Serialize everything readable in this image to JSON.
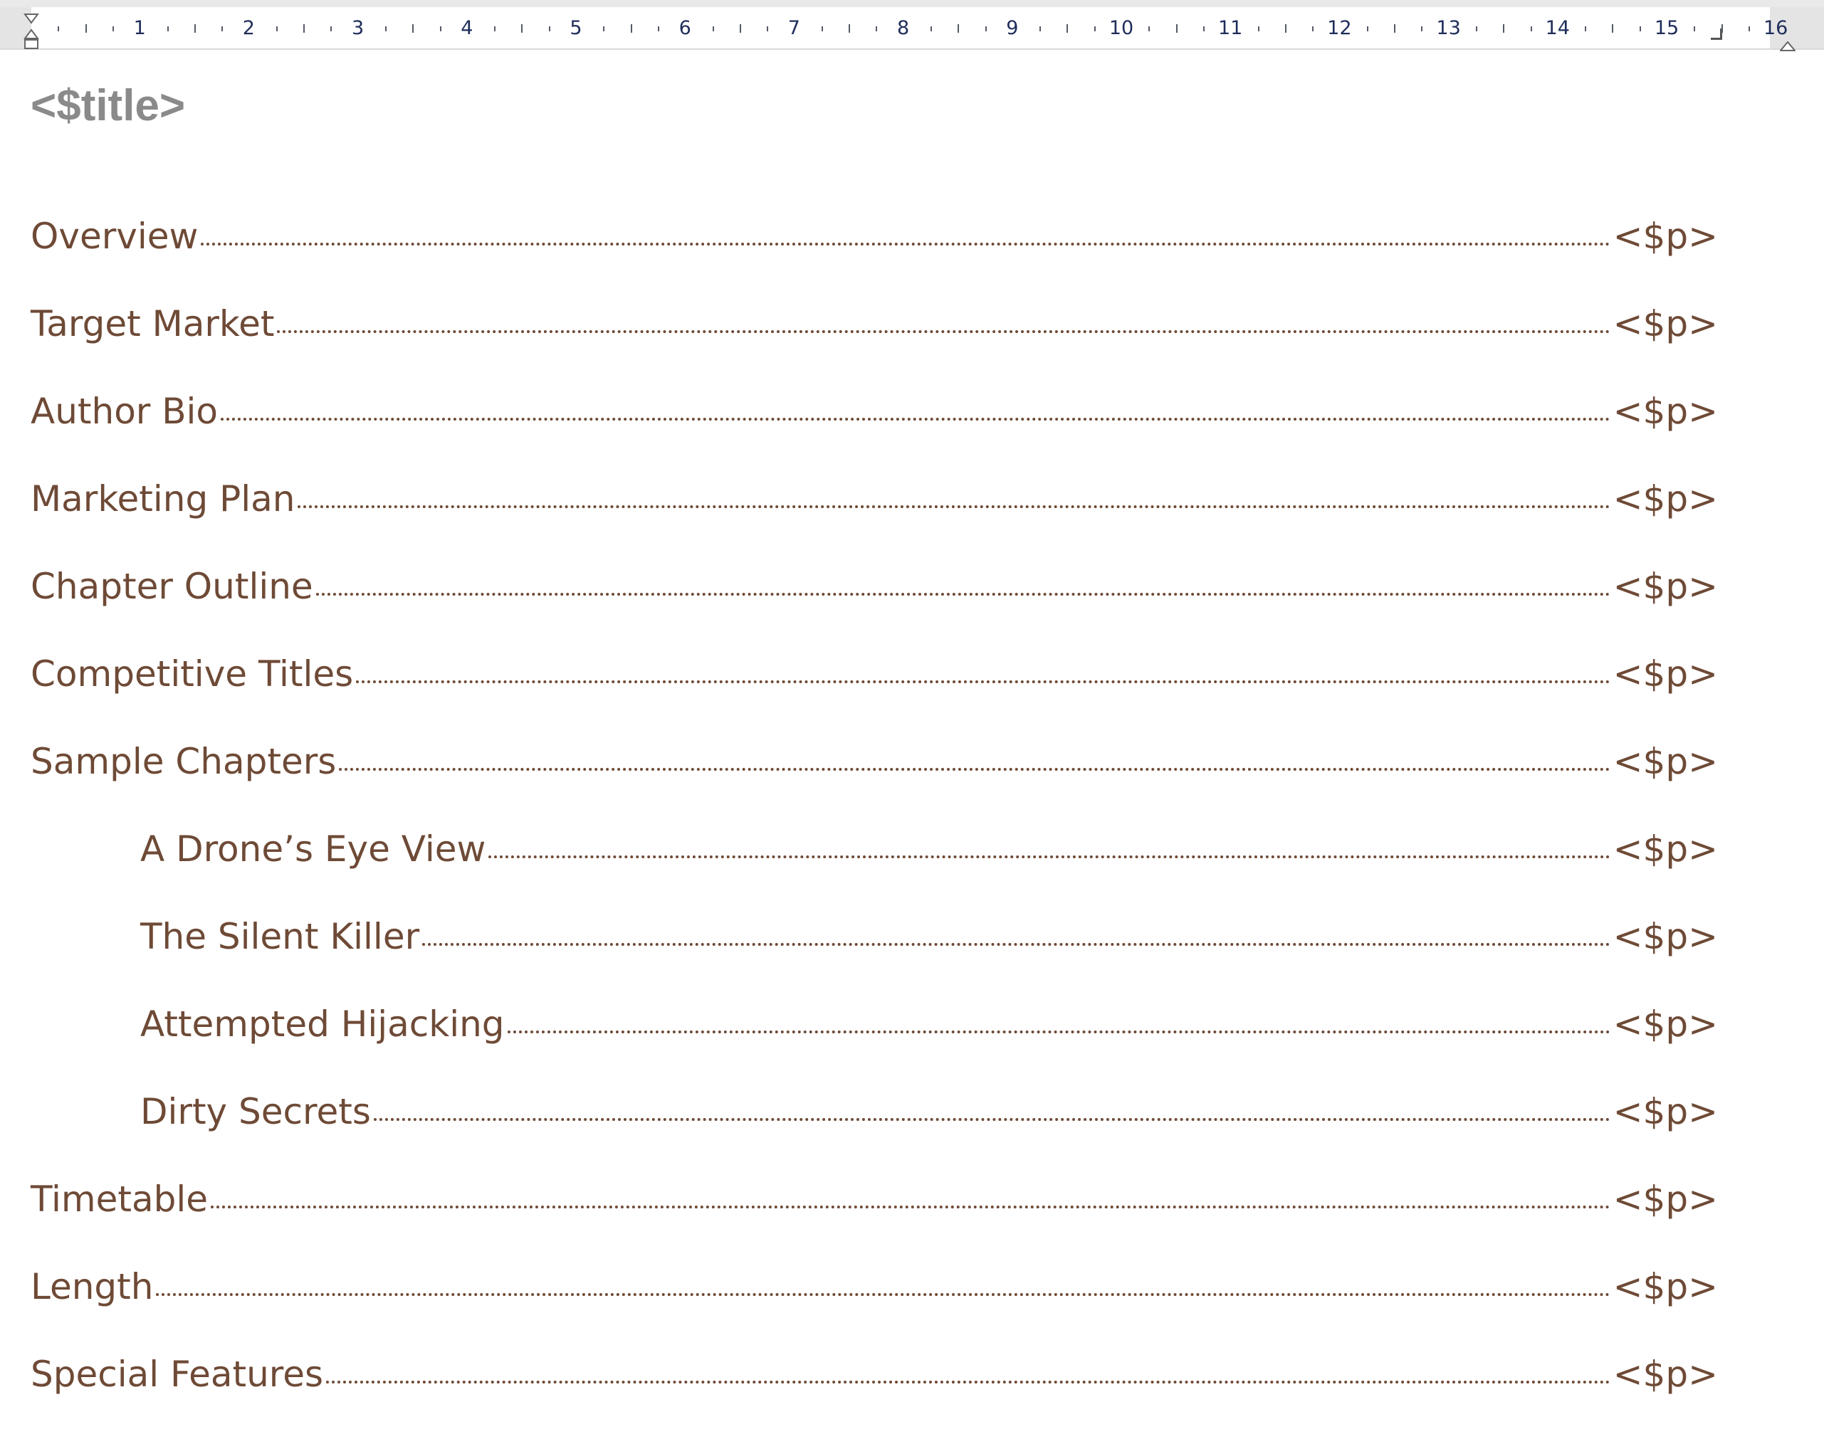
{
  "ruler": {
    "numbers": [
      "1",
      "2",
      "3",
      "4",
      "5",
      "6",
      "7",
      "8",
      "9",
      "10",
      "11",
      "12",
      "13",
      "14",
      "15",
      "16"
    ]
  },
  "document": {
    "title": "<$title>",
    "toc": [
      {
        "label": "Overview",
        "page": "<$p>",
        "level": 1
      },
      {
        "label": "Target Market",
        "page": "<$p>",
        "level": 1
      },
      {
        "label": "Author Bio",
        "page": "<$p>",
        "level": 1
      },
      {
        "label": "Marketing Plan",
        "page": "<$p>",
        "level": 1
      },
      {
        "label": "Chapter Outline",
        "page": "<$p>",
        "level": 1
      },
      {
        "label": "Competitive Titles",
        "page": "<$p>",
        "level": 1
      },
      {
        "label": "Sample Chapters",
        "page": "<$p>",
        "level": 1
      },
      {
        "label": "A Drone’s Eye View",
        "page": "<$p>",
        "level": 2
      },
      {
        "label": "The Silent Killer",
        "page": "<$p>",
        "level": 2
      },
      {
        "label": "Attempted Hijacking",
        "page": "<$p>",
        "level": 2
      },
      {
        "label": "Dirty Secrets",
        "page": "<$p>",
        "level": 2
      },
      {
        "label": "Timetable",
        "page": "<$p>",
        "level": 1
      },
      {
        "label": "Length",
        "page": "<$p>",
        "level": 1
      },
      {
        "label": "Special Features",
        "page": "<$p>",
        "level": 1
      }
    ]
  },
  "colors": {
    "toc_text": "#6e4a36",
    "title_text": "#8a8a8a",
    "ruler_numbers": "#1f2d5a"
  }
}
